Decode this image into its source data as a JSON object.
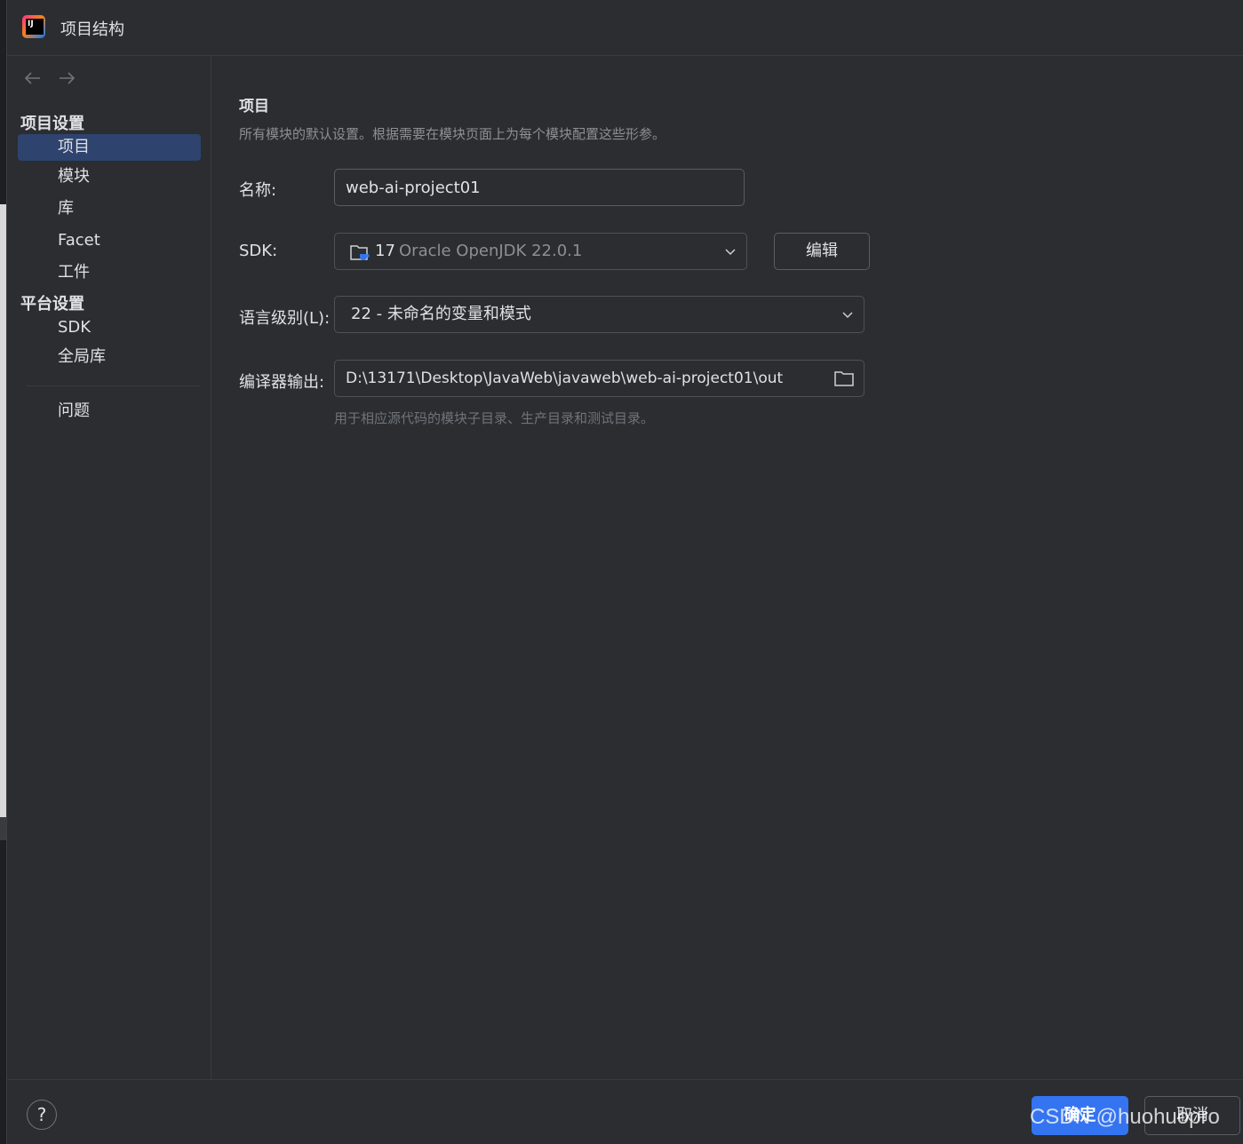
{
  "window": {
    "title": "项目结构"
  },
  "sidebar": {
    "groups": [
      {
        "header": "项目设置"
      },
      {
        "header": "平台设置"
      }
    ],
    "items": [
      {
        "label": "项目",
        "selected": true
      },
      {
        "label": "模块"
      },
      {
        "label": "库"
      },
      {
        "label": "Facet"
      },
      {
        "label": "工件"
      },
      {
        "label": "SDK"
      },
      {
        "label": "全局库"
      },
      {
        "label": "问题"
      }
    ]
  },
  "main": {
    "title": "项目",
    "description": "所有模块的默认设置。根据需要在模块页面上为每个模块配置这些形参。",
    "name_label": "名称:",
    "name_value": "web-ai-project01",
    "sdk_label": "SDK:",
    "sdk_version": "17",
    "sdk_name": "Oracle OpenJDK 22.0.1",
    "edit_label": "编辑",
    "language_label": "语言级别(L):",
    "language_value": "22 - 未命名的变量和模式",
    "output_label": "编译器输出:",
    "output_value": "D:\\13171\\Desktop\\JavaWeb\\javaweb\\web-ai-project01\\out",
    "output_hint": "用于相应源代码的模块子目录、生产目录和测试目录。"
  },
  "footer": {
    "help_label": "?",
    "ok_label": "确定",
    "cancel_label": "取消"
  },
  "watermark": "CSDN @huohuopro",
  "colors": {
    "accent": "#3574f0",
    "selection": "#2e436e",
    "background": "#2b2d30"
  }
}
